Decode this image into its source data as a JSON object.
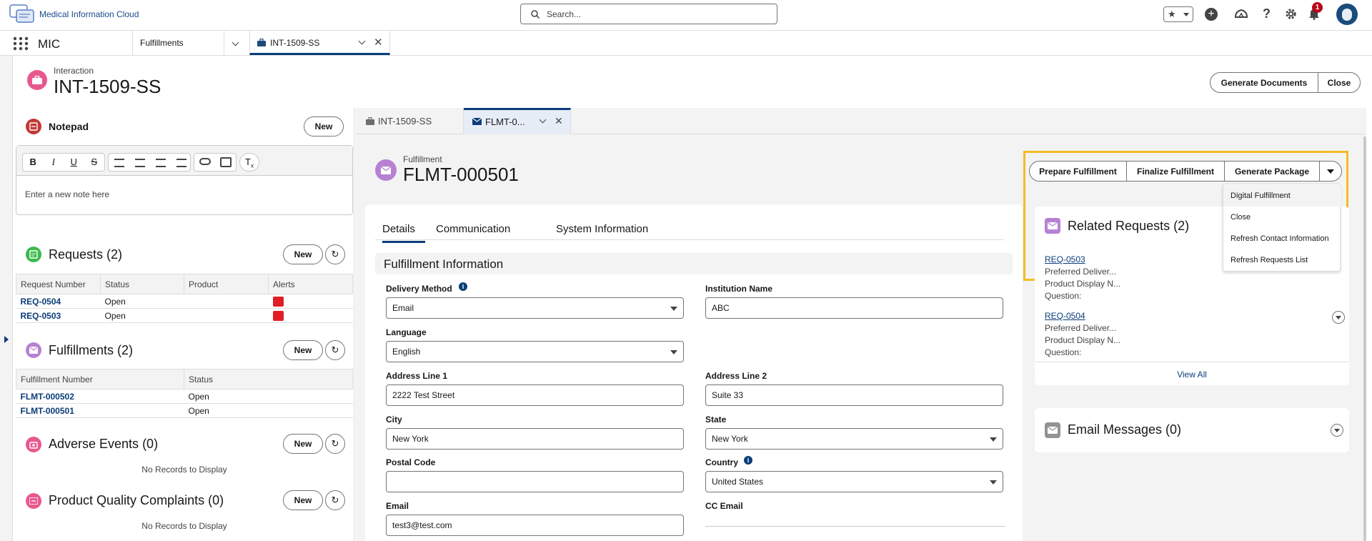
{
  "header": {
    "app_brand": "Medical Information Cloud",
    "search_placeholder": "Search...",
    "notification_count": "1"
  },
  "nav": {
    "app_name": "MIC",
    "tabs": [
      {
        "label": "Fulfillments"
      },
      {
        "label": "INT-1509-SS"
      }
    ]
  },
  "record": {
    "type_label": "Interaction",
    "title": "INT-1509-SS",
    "actions": {
      "generate_documents": "Generate Documents",
      "close": "Close"
    }
  },
  "left": {
    "notepad": {
      "title": "Notepad",
      "new_label": "New",
      "placeholder": "Enter a new note here"
    },
    "requests": {
      "title": "Requests (2)",
      "new_label": "New",
      "columns": [
        "Request Number",
        "Status",
        "Product",
        "Alerts"
      ],
      "rows": [
        {
          "number": "REQ-0504",
          "status": "Open",
          "product": ""
        },
        {
          "number": "REQ-0503",
          "status": "Open",
          "product": ""
        }
      ]
    },
    "fulfillments": {
      "title": "Fulfillments (2)",
      "new_label": "New",
      "columns": [
        "Fulfillment Number",
        "Status"
      ],
      "rows": [
        {
          "number": "FLMT-000502",
          "status": "Open"
        },
        {
          "number": "FLMT-000501",
          "status": "Open"
        }
      ]
    },
    "adverse_events": {
      "title": "Adverse Events (0)",
      "new_label": "New",
      "empty": "No Records to Display"
    },
    "pqc": {
      "title": "Product Quality Complaints (0)",
      "new_label": "New",
      "empty": "No Records to Display"
    }
  },
  "subtabs": [
    {
      "label": "INT-1509-SS"
    },
    {
      "label": "FLMT-0..."
    }
  ],
  "fulfillment": {
    "type_label": "Fulfillment",
    "title": "FLMT-000501",
    "actions": {
      "prepare": "Prepare Fulfillment",
      "finalize": "Finalize Fulfillment",
      "generate_package": "Generate Package"
    },
    "menu": [
      "Digital Fulfillment",
      "Close",
      "Refresh Contact Information",
      "Refresh Requests List"
    ],
    "tabs": [
      "Details",
      "Communication",
      "System Information"
    ],
    "section_title": "Fulfillment Information",
    "fields": {
      "delivery_method": {
        "label": "Delivery Method",
        "value": "Email"
      },
      "institution_name": {
        "label": "Institution Name",
        "value": "ABC"
      },
      "language": {
        "label": "Language",
        "value": "English"
      },
      "address1": {
        "label": "Address Line 1",
        "value": "2222 Test Street"
      },
      "address2": {
        "label": "Address Line 2",
        "value": "Suite 33"
      },
      "city": {
        "label": "City",
        "value": "New York"
      },
      "state": {
        "label": "State",
        "value": "New York"
      },
      "postal_code": {
        "label": "Postal Code",
        "value": ""
      },
      "country": {
        "label": "Country",
        "value": "United States"
      },
      "email": {
        "label": "Email",
        "value": "test3@test.com"
      },
      "cc_email": {
        "label": "CC Email",
        "value": ""
      }
    }
  },
  "related": {
    "title": "Related Requests (2)",
    "items": [
      {
        "number": "REQ-0503",
        "l1": "Preferred Deliver...",
        "l2": "Product Display N...",
        "l3": "Question:"
      },
      {
        "number": "REQ-0504",
        "l1": "Preferred Deliver...",
        "l2": "Product Display N...",
        "l3": "Question:"
      }
    ],
    "view_all": "View All"
  },
  "email_messages": {
    "title": "Email Messages (0)"
  },
  "colors": {
    "brand": "#0b3d7a",
    "highlight": "#f4bc25",
    "request_icon": "#3bba4c",
    "fulfillment_icon": "#b781d3",
    "interaction_icon": "#e8588e"
  }
}
